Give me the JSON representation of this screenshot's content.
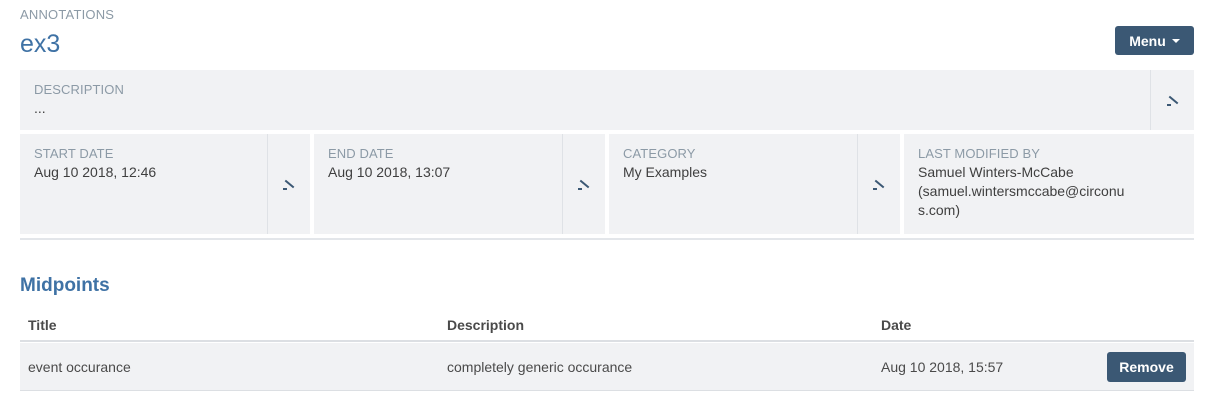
{
  "header": {
    "kicker": "ANNOTATIONS",
    "title": "ex3",
    "menu_label": "Menu"
  },
  "description": {
    "label": "DESCRIPTION",
    "value": "..."
  },
  "fields": [
    {
      "label": "START DATE",
      "value": "Aug 10 2018, 12:46"
    },
    {
      "label": "END DATE",
      "value": "Aug 10 2018, 13:07"
    },
    {
      "label": "CATEGORY",
      "value": "My Examples"
    },
    {
      "label": "LAST MODIFIED BY",
      "value_line1": "Samuel Winters-McCabe",
      "value_line2": "(samuel.wintersmccabe@circonu",
      "value_line3": "s.com)"
    }
  ],
  "midpoints": {
    "heading": "Midpoints",
    "columns": [
      "Title",
      "Description",
      "Date"
    ],
    "rows": [
      {
        "title": "event occurance",
        "description": "completely generic occurance",
        "date": "Aug 10 2018, 15:57",
        "action": "Remove"
      }
    ]
  },
  "colors": {
    "accent": "#3f72a5",
    "button": "#3b5874",
    "panel": "#f1f2f4"
  }
}
